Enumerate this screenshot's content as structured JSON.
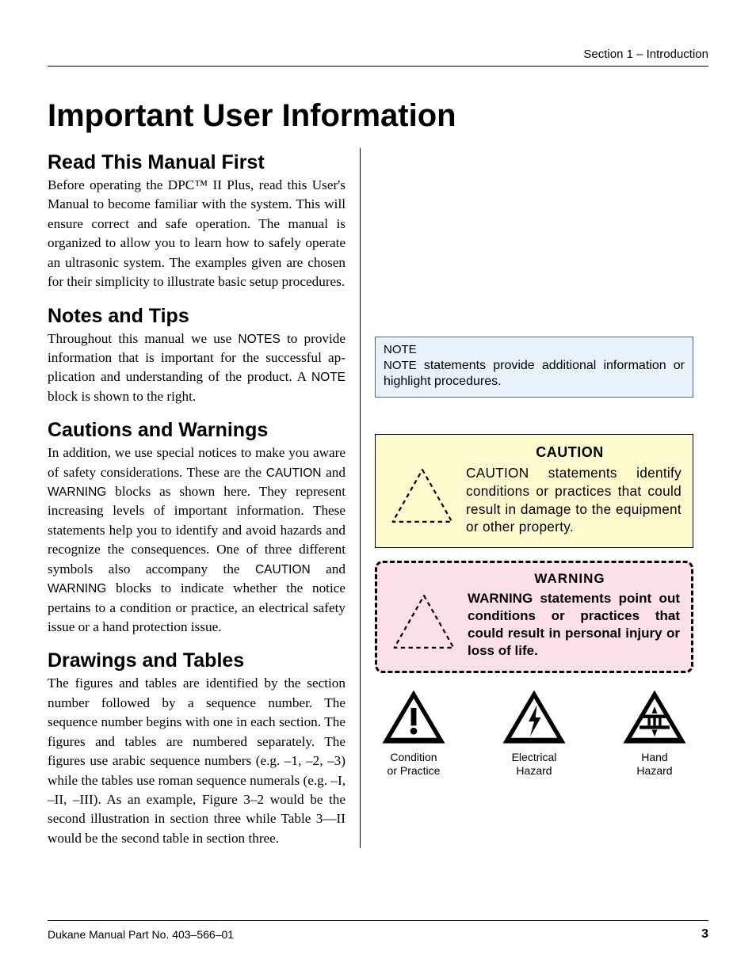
{
  "header": {
    "section_label": "Section 1 – Introduction"
  },
  "title": "Important User Information",
  "sections": {
    "read_first": {
      "heading": "Read This Manual First",
      "body": "Before operating the DPC™ II Plus, read this User's Manual to become familiar with the sys­tem. This will ensure correct and safe operation. The manual is organized to allow you to learn how to safely operate an ultrasonic system. The ex­amples given are chosen for their simplicity to il­lustrate basic setup procedures."
    },
    "notes_tips": {
      "heading": "Notes and Tips",
      "body_pre": "Throughout this manual we use ",
      "body_sc1": "NOTES",
      "body_mid": " to provide information that is important for the successful ap­plication and understanding of the product.  A ",
      "body_sc2": "NOTE",
      "body_post": " block is shown to the right."
    },
    "cautions_warnings": {
      "heading": "Cautions and Warnings",
      "body_pre": "In addition, we use special notices to make you aware of safety considerations. These are the ",
      "body_sc1": "CAU­TION",
      "body_mid1": " and ",
      "body_sc2": "WARNING",
      "body_mid2": " blocks as shown here. They represent increasing levels of important informa­tion. These statements help you to identify and avoid hazards and recognize the consequences. One of three different symbols also accompany the ",
      "body_sc3": "CAUTION",
      "body_mid3": " and ",
      "body_sc4": "WARNING",
      "body_post": " blocks to indicate whether the notice pertains to a condition or practice, an electrical safety issue or a hand protection issue."
    },
    "drawings_tables": {
      "heading": "Drawings and Tables",
      "body": "The figures and tables are identified by the sec­tion number followed by a sequence number. The sequence number begins with one in each sec­tion. The figures and tables are numbered sepa­rately. The figures use arabic sequence numbers (e.g. –1, –2, –3) while the tables use roman se­quence numerals (e.g. –I, –II, –III). As an ex­ample, Figure 3–2 would be the second illustra­tion in section three while  Table 3—II would be the second table in section three."
    }
  },
  "note_box": {
    "title": "NOTE",
    "body_sc": "NOTE",
    "body_rest": " statements provide additional informa­tion or highlight procedures."
  },
  "caution_box": {
    "title": "CAUTION",
    "body_sc": "CAUTION",
    "body_rest": " statements identify conditions or practices that could result in damage to the equip­ment or other property."
  },
  "warning_box": {
    "title": "WARNING",
    "body": "WARNING statements point out conditions or practices that could re­sult in personal injury or loss of life."
  },
  "symbols": {
    "condition": {
      "line1": "Condition",
      "line2": "or Practice"
    },
    "electrical": {
      "line1": "Electrical",
      "line2": "Hazard"
    },
    "hand": {
      "line1": "Hand",
      "line2": "Hazard"
    }
  },
  "footer": {
    "left": "Dukane Manual Part No. 403–566–01",
    "page": "3"
  }
}
